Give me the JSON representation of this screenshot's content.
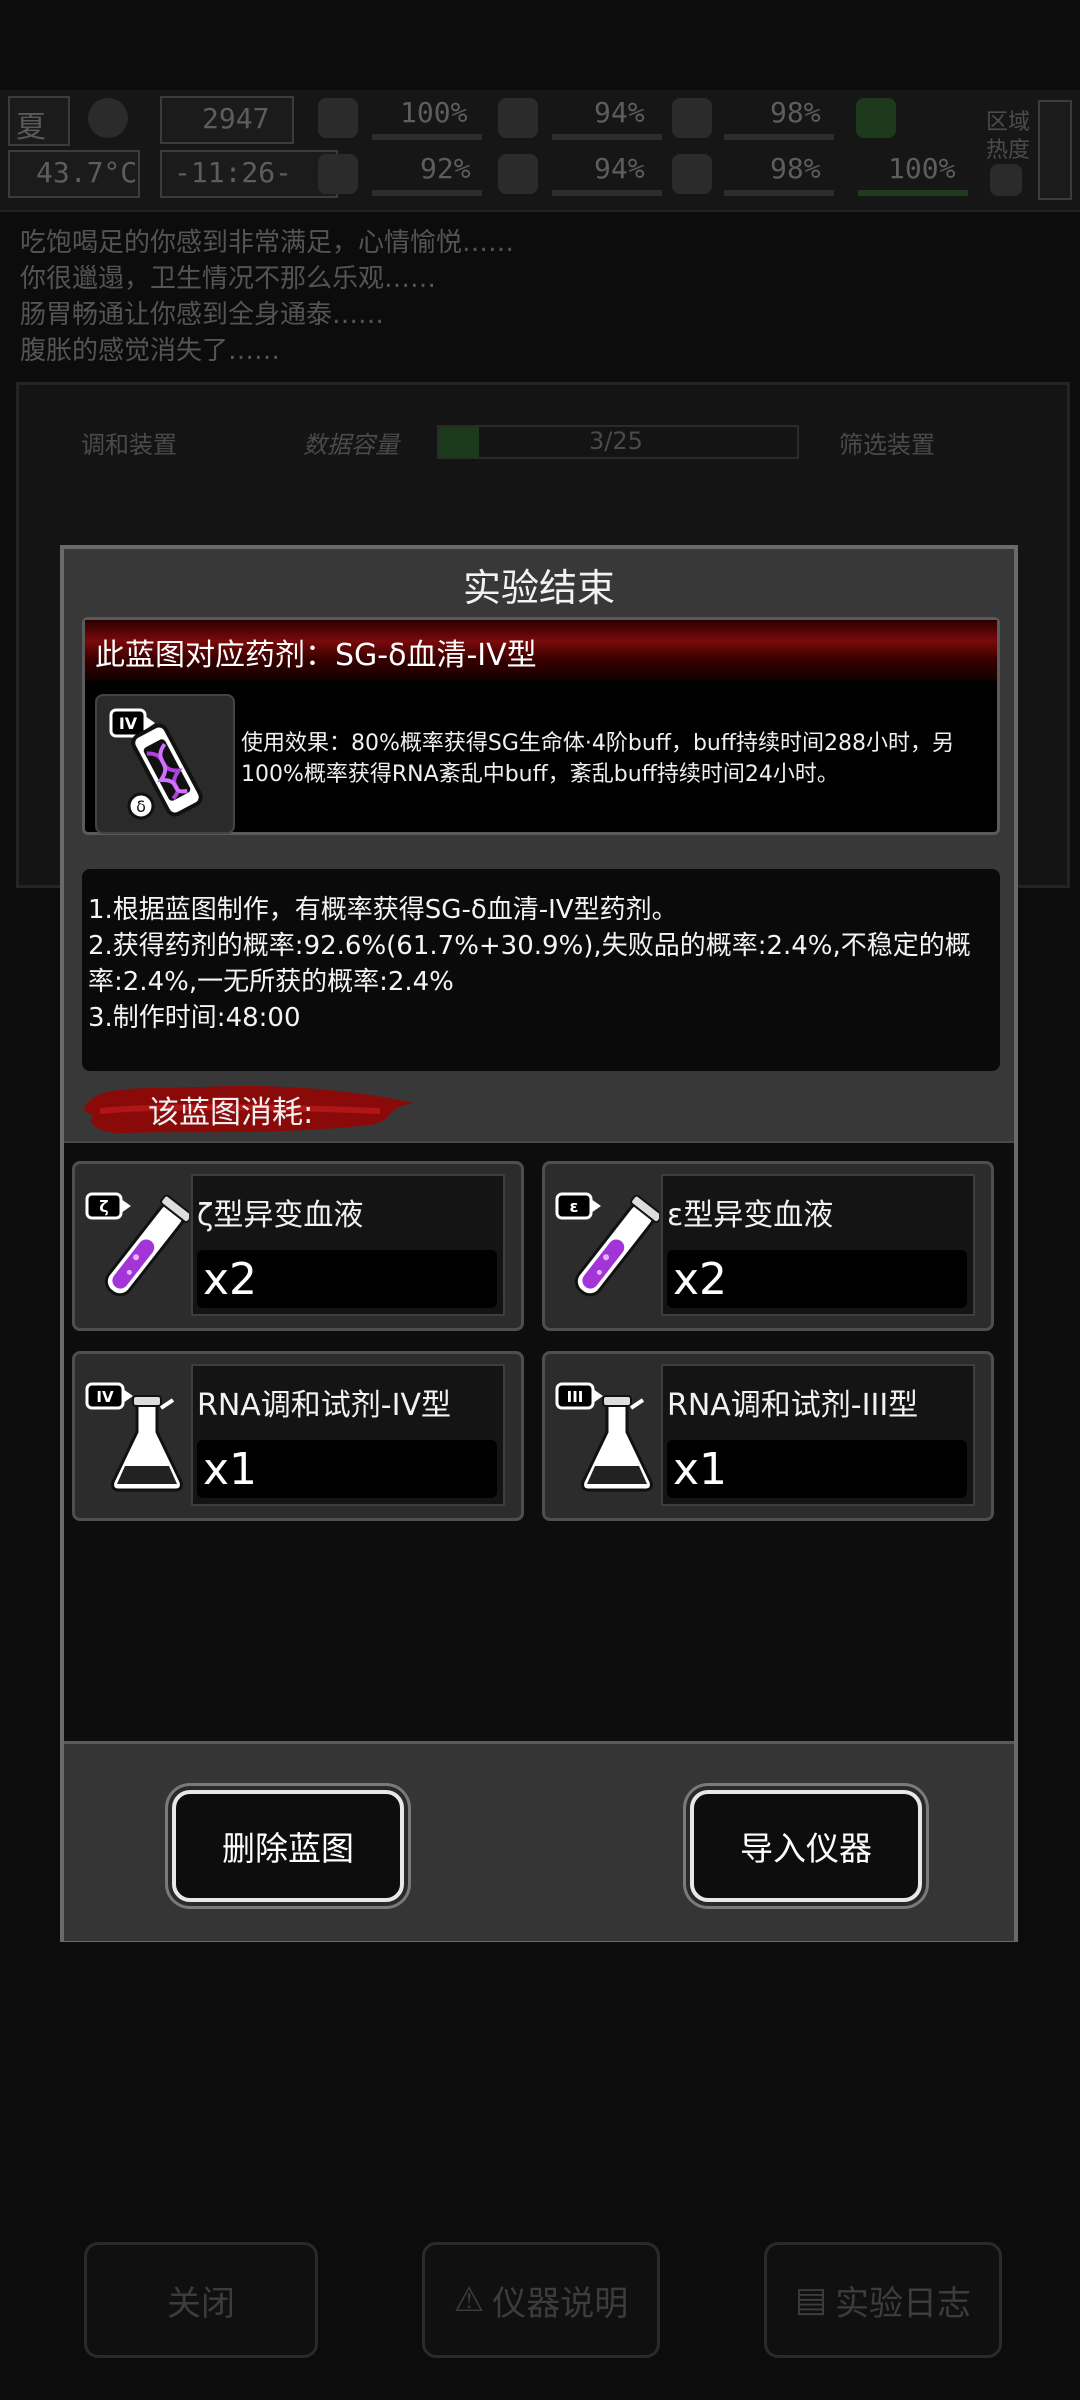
{
  "status": {
    "season": "夏",
    "temperature": "43.7°C",
    "day": "2947",
    "time": "-11:26-",
    "stats_top": [
      "100%",
      "94%",
      "98%"
    ],
    "stats_bottom": [
      "92%",
      "94%",
      "98%",
      "100%"
    ],
    "zone_label_1": "区域",
    "zone_label_2": "热度"
  },
  "log": [
    "吃饱喝足的你感到非常满足，心情愉悦……",
    "你很邋遢，卫生情况不那么乐观……",
    "肠胃畅通让你感到全身通泰……",
    "腹胀的感觉消失了……"
  ],
  "background_panel": {
    "left_label": "调和装置",
    "capacity_label": "数据容量",
    "capacity_value": "3/25",
    "right_label": "筛选装置"
  },
  "background_buttons": {
    "close": "关闭",
    "instrument_info": "仪器说明",
    "experiment_log": "实验日志"
  },
  "dialog": {
    "title": "实验结束",
    "blueprint_header": "此蓝图对应药剂：SG-δ血清-IV型",
    "blueprint_icon_badge": "IV",
    "effect_line1": "使用效果：80%概率获得SG生命体·4阶buff，buff持续时间288小时，另",
    "effect_line2": "100%概率获得RNA紊乱中buff，紊乱buff持续时间24小时。",
    "desc_line1": "1.根据蓝图制作，有概率获得SG-δ血清-IV型药剂。",
    "desc_line2": "2.获得药剂的概率:92.6%(61.7%+30.9%),失败品的概率:2.4%,不稳定的概",
    "desc_line3": "率:2.4%,一无所获的概率:2.4%",
    "desc_line4": "3.制作时间:48:00",
    "consume_label": "该蓝图消耗:",
    "materials": [
      {
        "badge": "ζ",
        "name": "ζ型异变血液",
        "qty": "x2"
      },
      {
        "badge": "ε",
        "name": "ε型异变血液",
        "qty": "x2"
      },
      {
        "badge": "IV",
        "name": "RNA调和试剂-IV型",
        "qty": "x1"
      },
      {
        "badge": "III",
        "name": "RNA调和试剂-III型",
        "qty": "x1"
      }
    ],
    "delete_button": "删除蓝图",
    "import_button": "导入仪器"
  },
  "colors": {
    "accent_red": "#8a0a0a",
    "liquid_purple": "#a335d8",
    "dialog_bg": "#383838"
  }
}
